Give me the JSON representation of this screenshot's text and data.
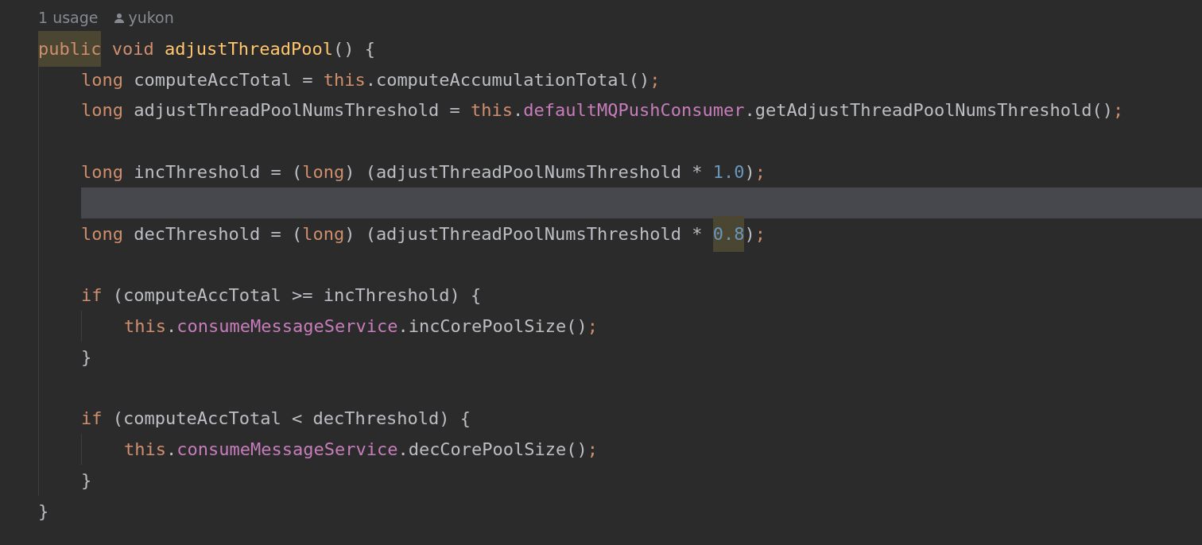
{
  "inlay_hint": {
    "usages": "1 usage",
    "author": "yukon"
  },
  "lines": [
    {
      "current": false,
      "tokens": [
        {
          "text": "public",
          "kind": "keyword",
          "highlighted": true
        },
        {
          "text": " void ",
          "kind": "keyword",
          "highlighted": false
        },
        {
          "text": "adjustThreadPool",
          "kind": "declaration",
          "highlighted": false
        },
        {
          "text": "() {",
          "kind": "plain",
          "highlighted": false
        }
      ],
      "children": [
        {
          "current": false,
          "tokens": [
            {
              "text": "long ",
              "kind": "keyword",
              "highlighted": false
            },
            {
              "text": "computeAccTotal = ",
              "kind": "plain",
              "highlighted": false
            },
            {
              "text": "this",
              "kind": "keyword",
              "highlighted": false
            },
            {
              "text": ".computeAccumulationTotal()",
              "kind": "plain",
              "highlighted": false
            },
            {
              "text": ";",
              "kind": "keyword",
              "highlighted": false
            }
          ]
        },
        {
          "current": false,
          "tokens": [
            {
              "text": "long ",
              "kind": "keyword",
              "highlighted": false
            },
            {
              "text": "adjustThreadPoolNumsThreshold = ",
              "kind": "plain",
              "highlighted": false
            },
            {
              "text": "this",
              "kind": "keyword",
              "highlighted": false
            },
            {
              "text": ".",
              "kind": "plain",
              "highlighted": false
            },
            {
              "text": "defaultMQPushConsumer",
              "kind": "field",
              "highlighted": false
            },
            {
              "text": ".getAdjustThreadPoolNumsThreshold()",
              "kind": "plain",
              "highlighted": false
            },
            {
              "text": ";",
              "kind": "keyword",
              "highlighted": false
            }
          ]
        },
        {
          "current": false
        },
        {
          "current": false,
          "tokens": [
            {
              "text": "long ",
              "kind": "keyword",
              "highlighted": false
            },
            {
              "text": "incThreshold = (",
              "kind": "plain",
              "highlighted": false
            },
            {
              "text": "long",
              "kind": "keyword",
              "highlighted": false
            },
            {
              "text": ") (adjustThreadPoolNumsThreshold * ",
              "kind": "plain",
              "highlighted": false
            },
            {
              "text": "1.0",
              "kind": "number",
              "highlighted": false
            },
            {
              "text": ")",
              "kind": "plain",
              "highlighted": false
            },
            {
              "text": ";",
              "kind": "keyword",
              "highlighted": false
            }
          ]
        },
        {
          "current": true
        },
        {
          "current": false,
          "tokens": [
            {
              "text": "long ",
              "kind": "keyword",
              "highlighted": false
            },
            {
              "text": "decThreshold = (",
              "kind": "plain",
              "highlighted": false
            },
            {
              "text": "long",
              "kind": "keyword",
              "highlighted": false
            },
            {
              "text": ") (adjustThreadPoolNumsThreshold * ",
              "kind": "plain",
              "highlighted": false
            },
            {
              "text": "0.8",
              "kind": "number",
              "highlighted": true
            },
            {
              "text": ")",
              "kind": "plain",
              "highlighted": false
            },
            {
              "text": ";",
              "kind": "keyword",
              "highlighted": false
            }
          ]
        },
        {
          "current": false
        },
        {
          "current": false,
          "tokens": [
            {
              "text": "if ",
              "kind": "keyword",
              "highlighted": false
            },
            {
              "text": "(computeAccTotal >= incThreshold) {",
              "kind": "plain",
              "highlighted": false
            }
          ],
          "children": [
            {
              "current": false,
              "tokens": [
                {
                  "text": "this",
                  "kind": "keyword",
                  "highlighted": false
                },
                {
                  "text": ".",
                  "kind": "plain",
                  "highlighted": false
                },
                {
                  "text": "consumeMessageService",
                  "kind": "field",
                  "highlighted": false
                },
                {
                  "text": ".incCorePoolSize()",
                  "kind": "plain",
                  "highlighted": false
                },
                {
                  "text": ";",
                  "kind": "keyword",
                  "highlighted": false
                }
              ]
            }
          ]
        },
        {
          "current": false,
          "tokens": [
            {
              "text": "}",
              "kind": "plain",
              "highlighted": false
            }
          ]
        },
        {
          "current": false
        },
        {
          "current": false,
          "tokens": [
            {
              "text": "if ",
              "kind": "keyword",
              "highlighted": false
            },
            {
              "text": "(computeAccTotal < decThreshold) {",
              "kind": "plain",
              "highlighted": false
            }
          ],
          "children": [
            {
              "current": false,
              "tokens": [
                {
                  "text": "this",
                  "kind": "keyword",
                  "highlighted": false
                },
                {
                  "text": ".",
                  "kind": "plain",
                  "highlighted": false
                },
                {
                  "text": "consumeMessageService",
                  "kind": "field",
                  "highlighted": false
                },
                {
                  "text": ".decCorePoolSize()",
                  "kind": "plain",
                  "highlighted": false
                },
                {
                  "text": ";",
                  "kind": "keyword",
                  "highlighted": false
                }
              ]
            }
          ]
        },
        {
          "current": false,
          "tokens": [
            {
              "text": "}",
              "kind": "plain",
              "highlighted": false
            }
          ]
        }
      ]
    },
    {
      "current": false,
      "tokens": [
        {
          "text": "}",
          "kind": "plain",
          "highlighted": false
        }
      ]
    }
  ]
}
